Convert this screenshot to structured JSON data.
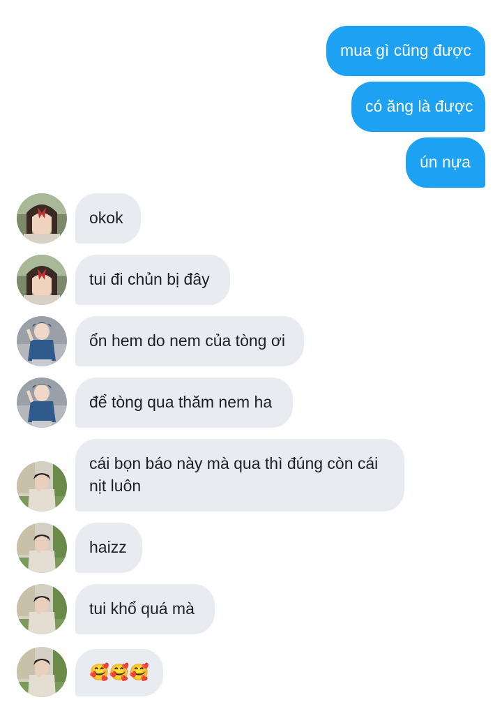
{
  "conversation": {
    "outgoing": [
      {
        "text": "mua gì cũng được"
      },
      {
        "text": "có ăng là được"
      },
      {
        "text": "ún nựa"
      }
    ],
    "incoming": [
      {
        "text": "okok",
        "avatar": "avatar-red-bow"
      },
      {
        "text": "tui đi chủn bị đây",
        "avatar": "avatar-red-bow"
      },
      {
        "text": "ổn hem do nem của tòng ơi",
        "avatar": "avatar-blue-jacket"
      },
      {
        "text": "để tòng qua thăm nem ha",
        "avatar": "avatar-blue-jacket"
      },
      {
        "text": "cái bọn báo này mà qua thì đúng còn cái nịt luôn",
        "avatar": "avatar-park"
      },
      {
        "text": "haizz",
        "avatar": "avatar-park"
      },
      {
        "text": "tui khổ quá mà",
        "avatar": "avatar-park"
      },
      {
        "text": "🥰🥰🥰",
        "avatar": "avatar-park"
      }
    ]
  },
  "colors": {
    "outgoing_bubble": "#1da1f2",
    "incoming_bubble": "#e8ecf0",
    "incoming_text": "#1c2024",
    "outgoing_text": "#ffffff"
  }
}
